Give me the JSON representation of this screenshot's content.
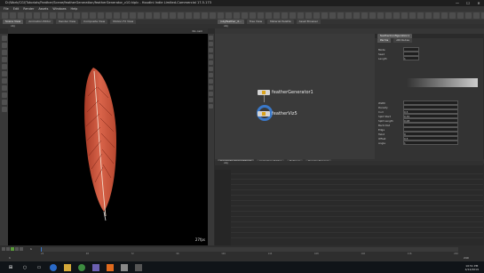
{
  "window": {
    "title": "D:/Work/CGI/Tutorials/Feather/Scene/featherGeneration/featherGenerator_v10.hiplc - Houdini Indie Limited-Commercial 17.5.173",
    "minimize": "—",
    "maximize": "☐",
    "close": "✕"
  },
  "menu": [
    "File",
    "Edit",
    "Render",
    "Assets",
    "Windows",
    "Help"
  ],
  "scene_tabs": [
    "Create",
    "Modify",
    "Polygon",
    "Deform",
    "Texture",
    "Rigging",
    "Muscles",
    "Characters",
    "Constraints",
    "Hair Utils",
    "Guide Process",
    "Terrain FX",
    "Simple FX",
    "Volume"
  ],
  "viewer": {
    "tabs": [
      "Scene View",
      "Animation Editor",
      "Render View",
      "Composite View",
      "Motion FX View"
    ],
    "path": "obj",
    "camera_label": "No cam",
    "fps": "27fps",
    "feather_color": "#c9523a"
  },
  "network": {
    "tabs": [
      "/obj/feather_d...",
      "Tree View",
      "Material Palette",
      "Asset Browser"
    ],
    "path": "obj",
    "nodes": [
      {
        "name": "featherGenerator1",
        "color": "#d9a21b"
      },
      {
        "name": "featherViz5",
        "color": "#d9a21b"
      }
    ]
  },
  "params": {
    "header": "featherConfiguration1",
    "tabs": [
      "Parms",
      "Attributes"
    ],
    "rows": [
      {
        "label": "Mode",
        "value": ""
      },
      {
        "label": "Seed",
        "value": ""
      },
      {
        "label": "Length",
        "value": "1"
      },
      {
        "label": "Width",
        "value": ""
      },
      {
        "label": "Density",
        "value": ""
      },
      {
        "label": "Curl",
        "value": "0.5"
      },
      {
        "label": "Split Start",
        "value": "0.35"
      },
      {
        "label": "Split Length",
        "value": "0.08"
      },
      {
        "label": "Barb Dist",
        "value": ""
      },
      {
        "label": "Edge",
        "value": ""
      },
      {
        "label": "Twist",
        "value": "0"
      },
      {
        "label": "Offset",
        "value": "0.5"
      },
      {
        "label": "Angle",
        "value": "1"
      }
    ]
  },
  "channels": {
    "tabs": [
      "Geometry Spreadsheet",
      "Animation Editor",
      "Hotkeys",
      "Render Preview"
    ],
    "path": "obj"
  },
  "timeline": {
    "frame": "1",
    "start": "1",
    "end": "240",
    "ticks": [
      "24",
      "48",
      "72",
      "96",
      "120",
      "144",
      "168",
      "192",
      "216",
      "240"
    ]
  },
  "taskbar": {
    "clock_time": "10:51 PM",
    "clock_date": "4/12/2019"
  }
}
